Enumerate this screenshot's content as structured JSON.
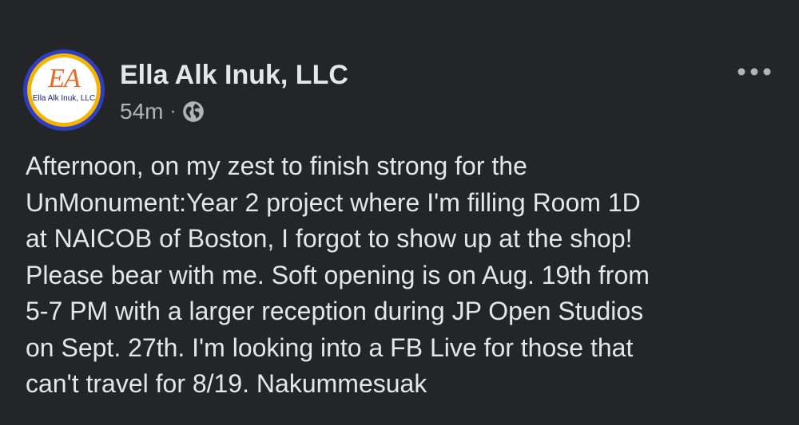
{
  "post": {
    "avatar": {
      "monogram": "EA",
      "caption": "Ella Alk Inuk, LLC"
    },
    "author": "Ella Alk Inuk, LLC",
    "timestamp": "54m",
    "separator": "·",
    "audience_icon": "globe-icon",
    "more_icon": "more-options-icon",
    "text": "Afternoon, on my zest to finish strong for the\nUnMonument:Year 2 project where I'm filling Room 1D\nat NAICOB of Boston, I forgot to show up at the shop!\nPlease bear with me. Soft opening is on Aug. 19th from\n5-7 PM with a larger reception during JP Open Studios\non Sept. 27th. I'm looking into a FB Live for those that\ncan't travel for 8/19. Nakummesuak"
  },
  "colors": {
    "background": "#242526",
    "primary_text": "#e4e6eb",
    "secondary_text": "#b0b3b8"
  }
}
